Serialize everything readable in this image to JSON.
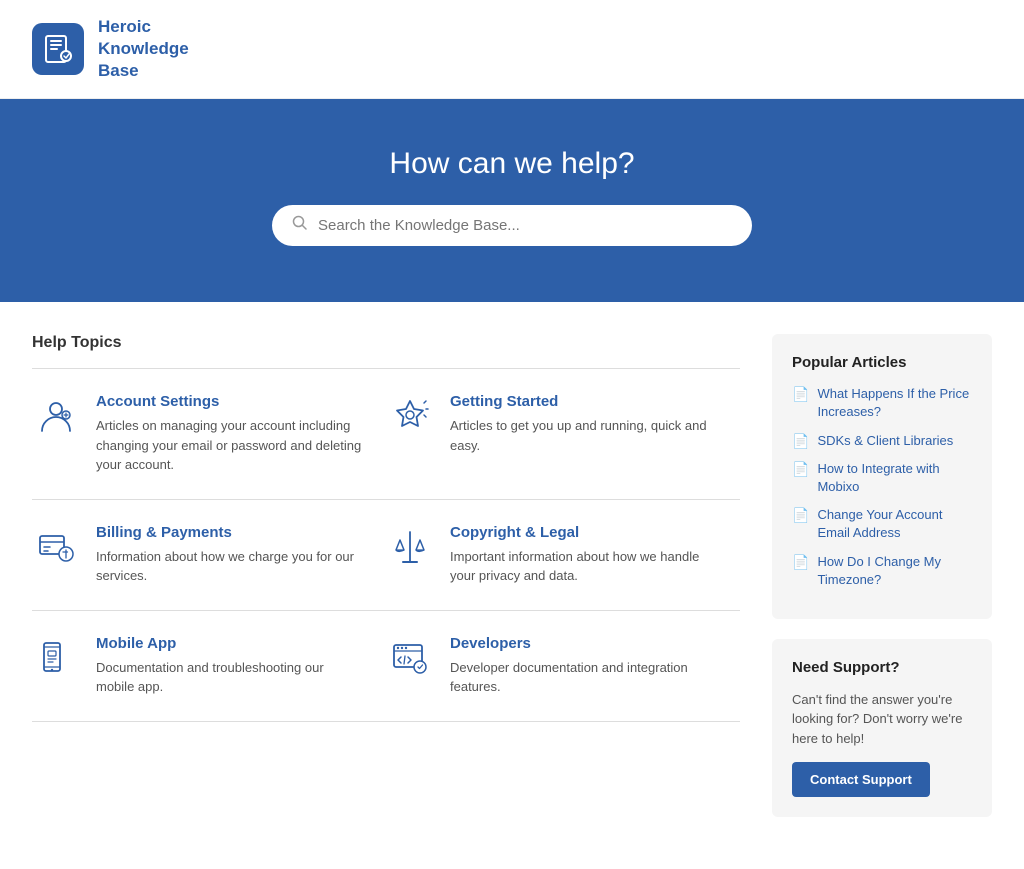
{
  "header": {
    "logo_text": "Heroic\nKnowledge\nBase",
    "logo_text_line1": "Heroic",
    "logo_text_line2": "Knowledge",
    "logo_text_line3": "Base"
  },
  "hero": {
    "title": "How can we help?",
    "search_placeholder": "Search the Knowledge Base..."
  },
  "topics_section": {
    "section_label": "Help Topics",
    "topics": [
      {
        "id": "account-settings",
        "name": "Account Settings",
        "desc": "Articles on managing your account including changing your email or password and deleting your account."
      },
      {
        "id": "getting-started",
        "name": "Getting Started",
        "desc": "Articles to get you up and running, quick and easy."
      },
      {
        "id": "billing-payments",
        "name": "Billing & Payments",
        "desc": "Information about how we charge you for our services."
      },
      {
        "id": "copyright-legal",
        "name": "Copyright & Legal",
        "desc": "Important information about how we handle your privacy and data."
      },
      {
        "id": "mobile-app",
        "name": "Mobile App",
        "desc": "Documentation and troubleshooting our mobile app."
      },
      {
        "id": "developers",
        "name": "Developers",
        "desc": "Developer documentation and integration features."
      }
    ]
  },
  "sidebar": {
    "popular_title": "Popular Articles",
    "articles": [
      {
        "label": "What Happens If the Price Increases?"
      },
      {
        "label": "SDKs & Client Libraries"
      },
      {
        "label": "How to Integrate with Mobixo"
      },
      {
        "label": "Change Your Account Email Address"
      },
      {
        "label": "How Do I Change My Timezone?"
      }
    ],
    "support_title": "Need Support?",
    "support_desc": "Can't find the answer you're looking for? Don't worry we're here to help!",
    "contact_label": "Contact Support"
  }
}
